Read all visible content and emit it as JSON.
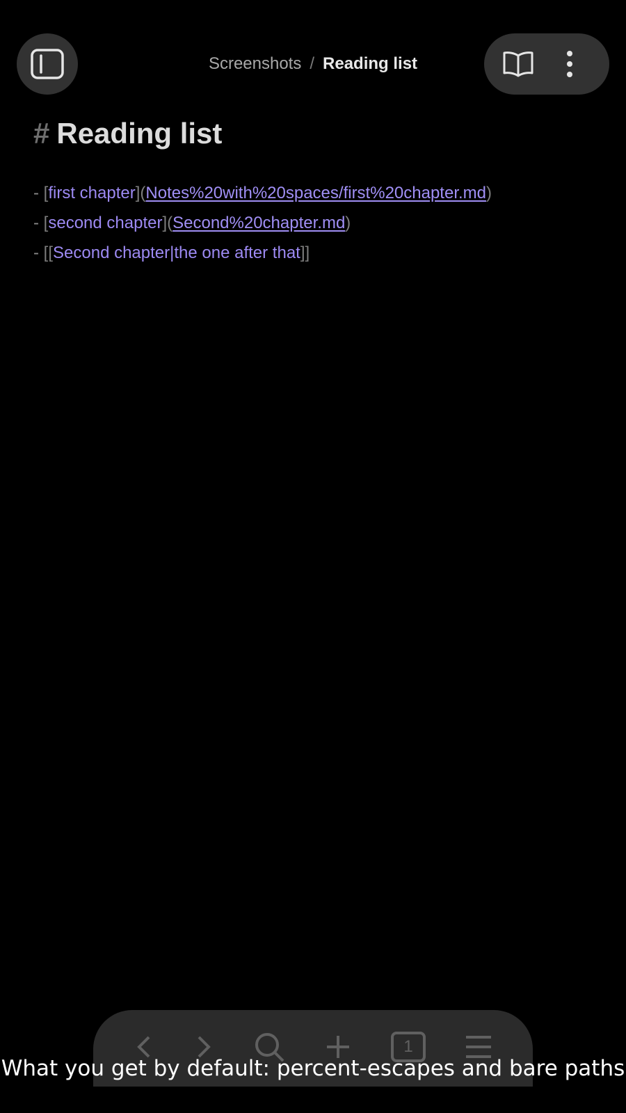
{
  "header": {
    "breadcrumb_parent": "Screenshots",
    "breadcrumb_separator": "/",
    "breadcrumb_current": "Reading list",
    "icons": [
      "sidebar-toggle-icon",
      "book-open-icon",
      "more-vertical-icon"
    ]
  },
  "editor": {
    "heading_hash": "#",
    "heading_text": "Reading list",
    "lines": [
      {
        "dash": "- ",
        "open": "[",
        "text": "first chapter",
        "mid": "](",
        "url": "Notes%20with%20spaces/first%20chapter.md",
        "close": ")"
      },
      {
        "dash": "- ",
        "open": "[",
        "text": "second chapter",
        "mid": "](",
        "url": "Second%20chapter.md",
        "close": ")"
      },
      {
        "dash": "- ",
        "open": "[[",
        "text": "Second chapter|the one after that",
        "close": "]]"
      }
    ]
  },
  "bottom_bar": {
    "tab_count": "1",
    "icons": [
      "back-icon",
      "forward-icon",
      "search-icon",
      "plus-icon",
      "tabs-icon",
      "menu-icon"
    ]
  },
  "caption": "What you get by default: percent-escapes and bare paths",
  "colors": {
    "background": "#000000",
    "link": "#9d8af3",
    "button_bg": "#323232"
  }
}
